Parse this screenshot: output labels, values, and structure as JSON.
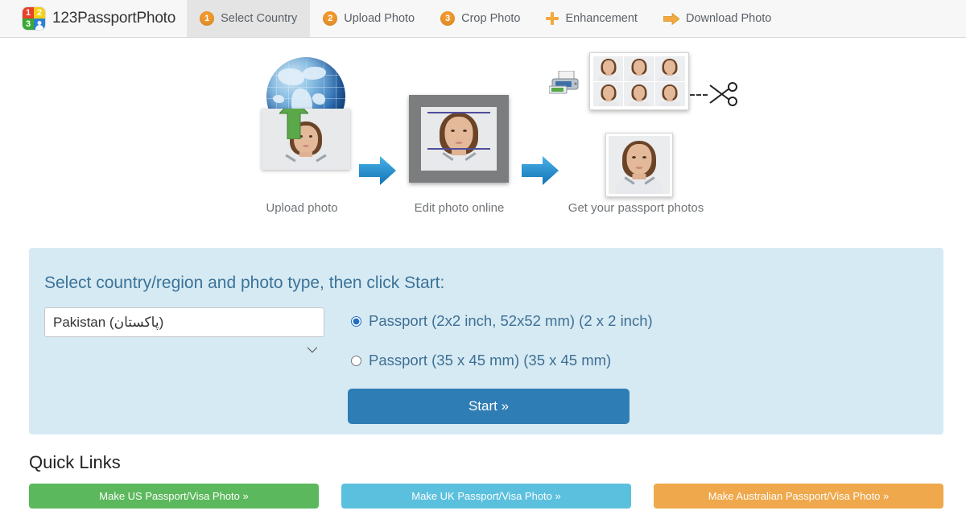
{
  "brand": {
    "name": "123PassportPhoto",
    "logo_cells": [
      "1",
      "2",
      "3",
      "person-icon"
    ]
  },
  "nav": {
    "items": [
      {
        "badge": "1",
        "label": "Select Country",
        "icon": "step-number-1-icon",
        "active": true
      },
      {
        "badge": "2",
        "label": "Upload Photo",
        "icon": "step-number-2-icon",
        "active": false
      },
      {
        "badge": "3",
        "label": "Crop Photo",
        "icon": "step-number-3-icon",
        "active": false
      },
      {
        "badge": "+",
        "label": "Enhancement",
        "icon": "plus-icon",
        "active": false
      },
      {
        "badge": "→",
        "label": "Download Photo",
        "icon": "right-arrow-icon",
        "active": false
      }
    ]
  },
  "hero": {
    "steps": [
      {
        "caption": "Upload photo",
        "icon": "globe-icon"
      },
      {
        "caption": "Edit photo online",
        "icon": "photo-editor-icon"
      },
      {
        "caption": "Get your passport photos",
        "icon": "printed-sheet-icon"
      }
    ]
  },
  "panel": {
    "title": "Select country/region and photo type, then click Start:",
    "country": {
      "selected": "Pakistan (پاکستان)",
      "options": [
        "Pakistan (پاکستان)"
      ]
    },
    "photo_types": [
      {
        "label": "Passport (2x2 inch, 52x52 mm) (2 x 2 inch)",
        "selected": true
      },
      {
        "label": "Passport (35 x 45 mm) (35 x 45 mm)",
        "selected": false
      }
    ],
    "start_label": "Start »"
  },
  "quick_links": {
    "title": "Quick Links",
    "buttons": [
      {
        "label": "Make US Passport/Visa Photo »",
        "color": "#5cb85c"
      },
      {
        "label": "Make UK Passport/Visa Photo »",
        "color": "#5bc0de"
      },
      {
        "label": "Make Australian Passport/Visa Photo »",
        "color": "#efa84b"
      }
    ]
  },
  "colors": {
    "nav_bg": "#f7f7f7",
    "nav_active_bg": "#e4e4e4",
    "badge_orange": "#f0982d",
    "panel_bg": "#d6eaf4",
    "panel_title": "#3c7398",
    "start_button": "#2f7db5",
    "arrow_blue": "#2d9bd6"
  }
}
